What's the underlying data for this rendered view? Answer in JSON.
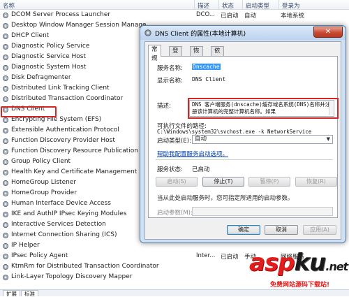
{
  "list_header": {
    "name_col": "名称",
    "desc_col": "描述",
    "status_col": "状态",
    "startup_col": "启动类型",
    "logon_col": "登录为"
  },
  "services": [
    {
      "name": "DCOM Server Process Launcher",
      "desc": "DCO...",
      "status": "已启动",
      "startup": "自动",
      "logon": "本地系统"
    },
    {
      "name": "Desktop Window Manager Session Manage",
      "desc": "",
      "status": "",
      "startup": "",
      "logon": ""
    },
    {
      "name": "DHCP Client",
      "desc": "",
      "status": "",
      "startup": "",
      "logon": ""
    },
    {
      "name": "Diagnostic Policy Service",
      "desc": "",
      "status": "",
      "startup": "",
      "logon": ""
    },
    {
      "name": "Diagnostic Service Host",
      "desc": "",
      "status": "",
      "startup": "",
      "logon": ""
    },
    {
      "name": "Diagnostic System Host",
      "desc": "",
      "status": "",
      "startup": "",
      "logon": ""
    },
    {
      "name": "Disk Defragmenter",
      "desc": "",
      "status": "",
      "startup": "",
      "logon": ""
    },
    {
      "name": "Distributed Link Tracking Client",
      "desc": "",
      "status": "",
      "startup": "",
      "logon": ""
    },
    {
      "name": "Distributed Transaction Coordinator",
      "desc": "",
      "status": "",
      "startup": "",
      "logon": ""
    },
    {
      "name": "DNS Client",
      "desc": "",
      "status": "",
      "startup": "",
      "logon": ""
    },
    {
      "name": "Encrypting File System (EFS)",
      "desc": "",
      "status": "",
      "startup": "",
      "logon": ""
    },
    {
      "name": "Extensible Authentication Protocol",
      "desc": "",
      "status": "",
      "startup": "",
      "logon": ""
    },
    {
      "name": "Function Discovery Provider Host",
      "desc": "",
      "status": "",
      "startup": "",
      "logon": ""
    },
    {
      "name": "Function Discovery Resource Publication",
      "desc": "",
      "status": "",
      "startup": "",
      "logon": ""
    },
    {
      "name": "Group Policy Client",
      "desc": "",
      "status": "",
      "startup": "",
      "logon": ""
    },
    {
      "name": "Health Key and Certificate Management",
      "desc": "",
      "status": "",
      "startup": "",
      "logon": ""
    },
    {
      "name": "HomeGroup Listener",
      "desc": "",
      "status": "",
      "startup": "",
      "logon": ""
    },
    {
      "name": "HomeGroup Provider",
      "desc": "",
      "status": "",
      "startup": "",
      "logon": ""
    },
    {
      "name": "Human Interface Device Access",
      "desc": "",
      "status": "",
      "startup": "",
      "logon": ""
    },
    {
      "name": "IKE and AuthIP IPsec Keying Modules",
      "desc": "",
      "status": "",
      "startup": "",
      "logon": ""
    },
    {
      "name": "Interactive Services Detection",
      "desc": "",
      "status": "",
      "startup": "",
      "logon": ""
    },
    {
      "name": "Internet Connection Sharing (ICS)",
      "desc": "",
      "status": "",
      "startup": "",
      "logon": ""
    },
    {
      "name": "IP Helper",
      "desc": "",
      "status": "",
      "startup": "",
      "logon": ""
    },
    {
      "name": "IPsec Policy Agent",
      "desc": "Inter...",
      "status": "已启动",
      "startup": "手动",
      "logon": "网络服务"
    },
    {
      "name": "KtmRm for Distributed Transaction Coordinator",
      "desc": "",
      "status": "",
      "startup": "",
      "logon": ""
    },
    {
      "name": "Link-Layer Topology Discovery Mapper",
      "desc": "",
      "status": "",
      "startup": "",
      "logon": ""
    }
  ],
  "bottom_tabs": [
    "扩展",
    "标准"
  ],
  "dialog": {
    "title": "DNS Client 的属性(本地计算机)",
    "close_label": "✕",
    "tabs": [
      "常规",
      "登录",
      "恢复",
      "依存关系"
    ],
    "service_name_label": "服务名称:",
    "service_name_value": "Dnscache",
    "display_name_label": "显示名称:",
    "display_name_value": "DNS Client",
    "description_label": "描述:",
    "description_text": "DNS 客户端服务(dnscache)缓存域名系统(DNS)名称并注册该计算机的完整计算机名称。如果",
    "exe_path_label": "可执行文件的路径:",
    "exe_path_value": "C:\\Windows\\system32\\svchost.exe -k NetworkService",
    "startup_type_label": "启动类型(E):",
    "startup_type_value": "自动",
    "help_link": "帮助我配置服务启动选项。",
    "service_status_label": "服务状态:",
    "service_status_value": "已启动",
    "btn_start": "启动(S)",
    "btn_stop": "停止(T)",
    "btn_pause": "暂停(P)",
    "btn_resume": "恢复(R)",
    "start_params_hint": "当从此处启动服务时，您可指定所适用的启动参数。",
    "start_params_label": "启动参数(M):",
    "btn_ok": "确定",
    "btn_cancel": "取消",
    "btn_apply": "应用(A)"
  },
  "watermark": {
    "brand_asp": "asp",
    "brand_ku": "ku",
    "brand_net": ".net",
    "tagline": "免费网站源码下载站!"
  },
  "colors": {
    "highlight_red": "#d22525",
    "selection_blue": "#3399ff",
    "link_blue": "#0645ad"
  }
}
